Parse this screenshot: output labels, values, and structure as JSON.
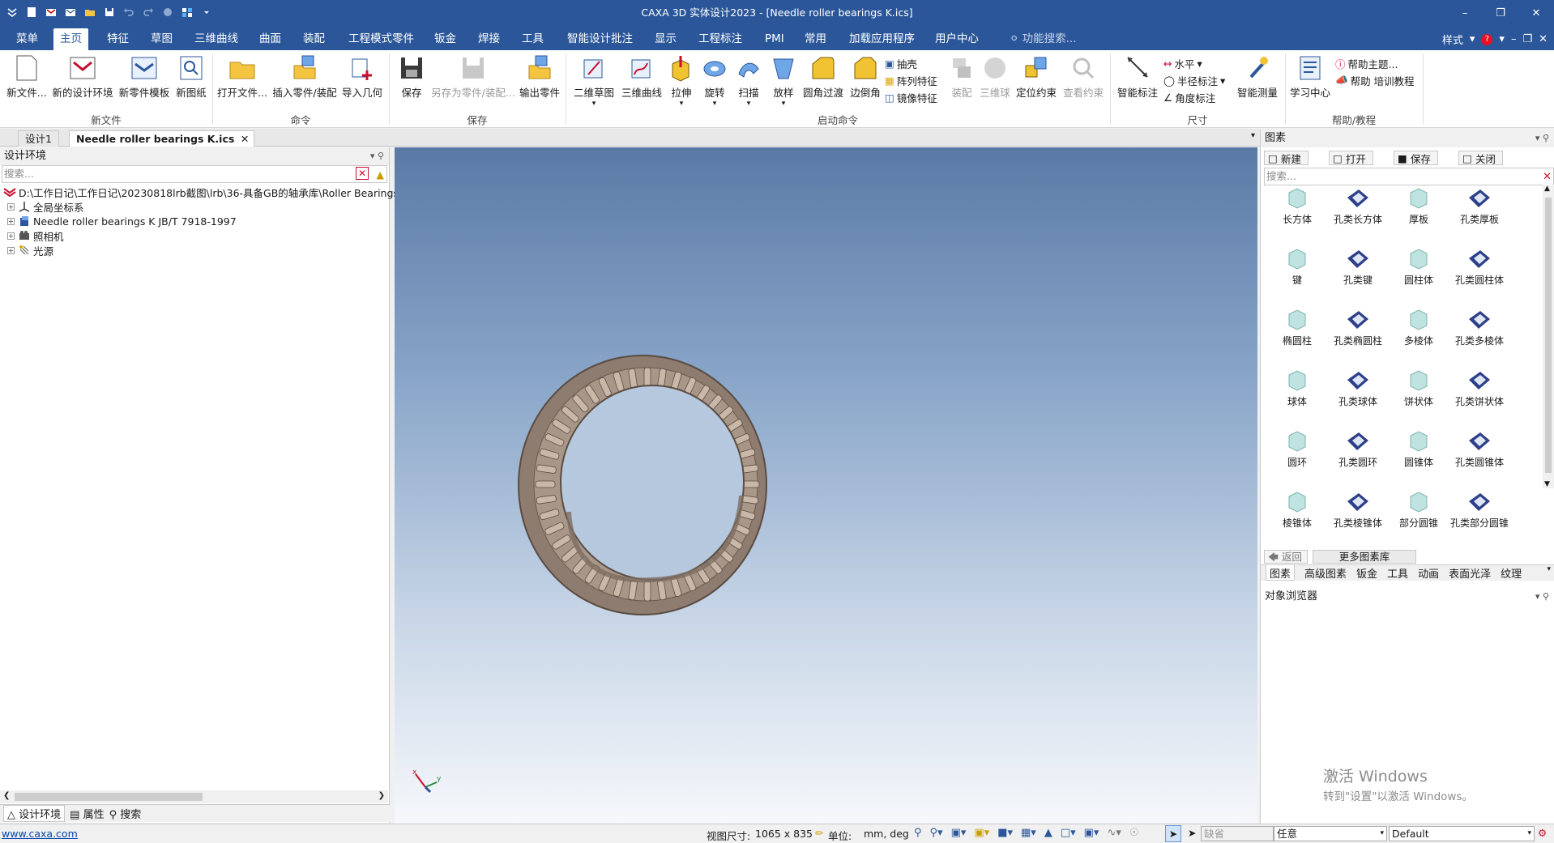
{
  "window": {
    "title": "CAXA 3D 实体设计2023 - [Needle roller bearings K.ics]"
  },
  "menu_tabs": [
    "菜单",
    "主页",
    "特征",
    "草图",
    "三维曲线",
    "曲面",
    "装配",
    "工程模式零件",
    "钣金",
    "焊接",
    "工具",
    "智能设计批注",
    "显示",
    "工程标注",
    "PMI",
    "常用",
    "加载应用程序",
    "用户中心"
  ],
  "menu_search_placeholder": "功能搜索...",
  "menu_style": "样式",
  "ribbon": {
    "new_file": "新文件...",
    "new_design_env": "新的设计环境",
    "new_part_template": "新零件模板",
    "new_drawing": "新图纸",
    "open_file": "打开文件...",
    "insert_part": "插入零件/装配",
    "import_geometry": "导入几何",
    "save": "保存",
    "save_as_part": "另存为零件/装配...",
    "export_part": "输出零件",
    "sketch_2d": "二维草图",
    "curve_3d": "三维曲线",
    "extrude": "拉伸",
    "revolve": "旋转",
    "sweep": "扫描",
    "loft": "放样",
    "fillet": "圆角过渡",
    "chamfer": "边倒角",
    "shell": "抽壳",
    "pattern": "阵列特征",
    "mirror": "镜像特征",
    "assembly": "装配",
    "ball_3d": "三维球",
    "position_constraint": "定位约束",
    "view_constraint": "查看约束",
    "smart_dimension": "智能标注",
    "horizontal": "水平",
    "radius_dim": "半径标注",
    "angle_dim": "角度标注",
    "smart_measure": "智能测量",
    "learning_center": "学习中心",
    "help_topics": "帮助主题...",
    "help_training": "帮助 培训教程",
    "groups": {
      "new_file": "新文件",
      "command": "命令",
      "save": "保存",
      "launch": "启动命令",
      "dimension": "尺寸",
      "help": "帮助/教程"
    }
  },
  "doc_tabs": [
    "设计1",
    "Needle roller bearings K.ics"
  ],
  "left_panel": {
    "title": "设计环境",
    "search_placeholder": "搜索...",
    "tree": [
      "D:\\工作日记\\工作日记\\20230818lrb截图\\lrb\\36-具备GB的轴承库\\Roller Bearings\\",
      "全局坐标系",
      "Needle roller bearings K JB/T 7918-1997",
      "照相机",
      "光源"
    ],
    "bottom_tabs": [
      "设计环境",
      "属性",
      "搜索"
    ]
  },
  "right_panel": {
    "title": "图素",
    "buttons": [
      "新建",
      "打开",
      "保存",
      "关闭"
    ],
    "search_placeholder": "搜索...",
    "items": [
      "长方体",
      "孔类长方体",
      "厚板",
      "孔类厚板",
      "键",
      "孔类键",
      "圆柱体",
      "孔类圆柱体",
      "椭圆柱",
      "孔类椭圆柱",
      "多棱体",
      "孔类多棱体",
      "球体",
      "孔类球体",
      "饼状体",
      "孔类饼状体",
      "圆环",
      "孔类圆环",
      "圆锥体",
      "孔类圆锥体",
      "棱锥体",
      "孔类棱锥体",
      "部分圆锥",
      "孔类部分圆锥"
    ],
    "back": "返回",
    "more": "更多图素库",
    "tabs": [
      "图素",
      "高级图素",
      "钣金",
      "工具",
      "动画",
      "表面光泽",
      "纹理"
    ],
    "object_browser": "对象浏览器",
    "watermark_title": "激活 Windows",
    "watermark_sub": "转到\"设置\"以激活 Windows。"
  },
  "status": {
    "link": "www.caxa.com",
    "view_size_label": "视图尺寸:",
    "view_size": "1065 x  835",
    "unit_label": "单位:",
    "unit": "mm, deg",
    "combo1": "缺省",
    "combo2": "任意",
    "combo3": "Default"
  },
  "colors": {
    "ribbon_blue": "#2b579a",
    "bearing": "#8d7c6f"
  }
}
